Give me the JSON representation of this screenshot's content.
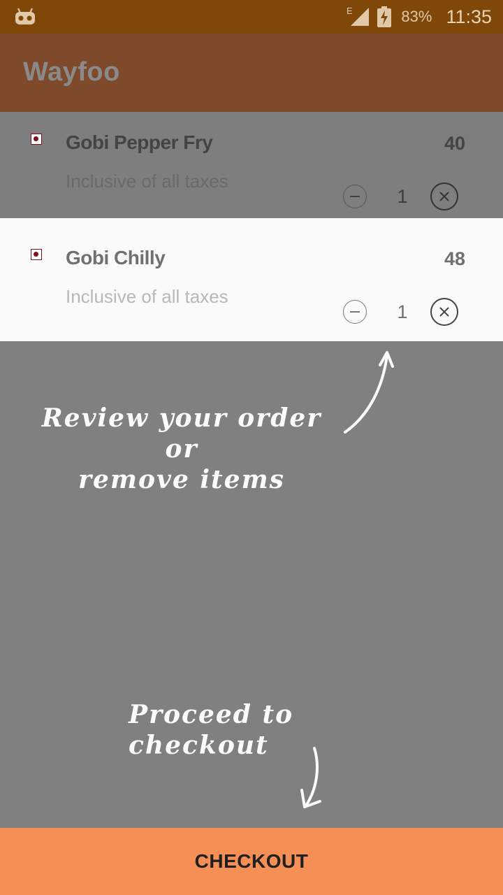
{
  "status_bar": {
    "network": "E",
    "battery": "83%",
    "time": "11:35"
  },
  "app": {
    "title": "Wayfoo"
  },
  "cart": {
    "items": [
      {
        "name": "Gobi Pepper Fry",
        "price": "40",
        "tax_note": "Inclusive of all taxes",
        "quantity": "1"
      },
      {
        "name": "Gobi Chilly",
        "price": "48",
        "tax_note": "Inclusive of all taxes",
        "quantity": "1"
      }
    ]
  },
  "hints": {
    "review_line1": "Review your order or",
    "review_line2": "remove items",
    "checkout": "Proceed to checkout"
  },
  "checkout_button": {
    "label": "CHECKOUT"
  },
  "colors": {
    "status_bar": "#7f4708",
    "app_bar": "#7f4a2c",
    "overlay": "#808080",
    "checkout": "#f58f55",
    "veg_mark": "#7a1020"
  }
}
